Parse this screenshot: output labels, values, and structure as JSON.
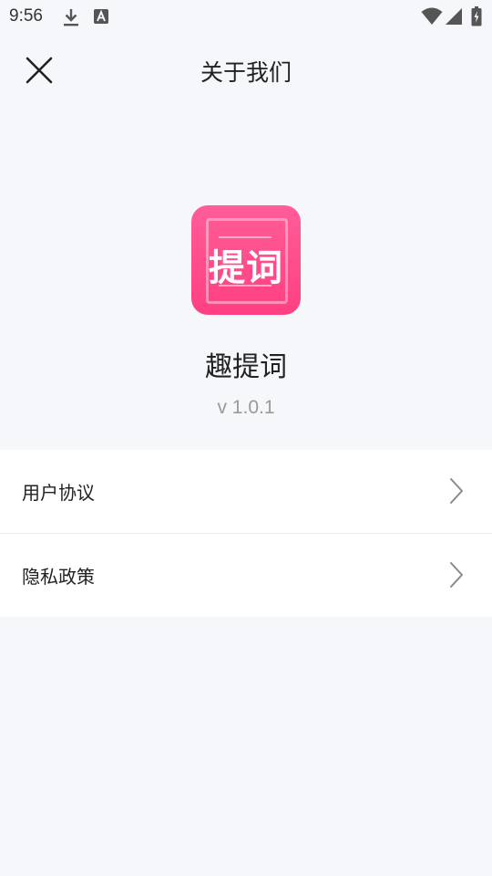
{
  "status_bar": {
    "time": "9:56",
    "icons": [
      "download-icon",
      "keyboard-a-icon",
      "wifi-icon",
      "signal-icon",
      "battery-charging-icon"
    ]
  },
  "header": {
    "title": "关于我们",
    "close_icon": "close-icon"
  },
  "app": {
    "logo_text": "提词",
    "name": "趣提词",
    "version": "v 1.0.1",
    "brand_color": "#ff4785"
  },
  "menu": {
    "items": [
      {
        "label": "用户协议",
        "icon": "chevron-right-icon"
      },
      {
        "label": "隐私政策",
        "icon": "chevron-right-icon"
      }
    ]
  }
}
